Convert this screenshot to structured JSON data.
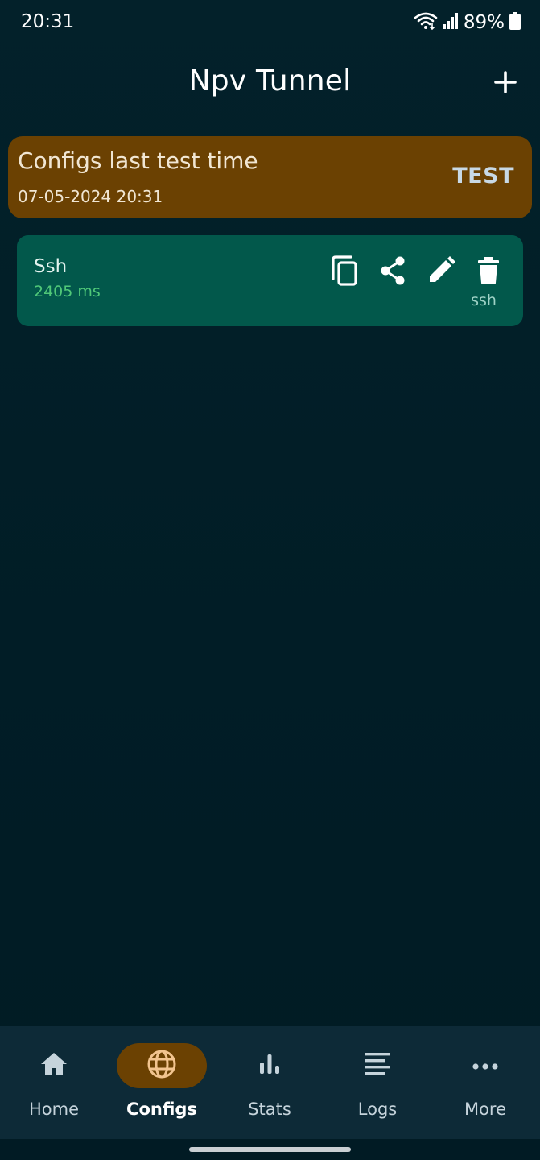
{
  "status_bar": {
    "time": "20:31",
    "battery_percent": "89%",
    "icons": [
      "wifi-icon",
      "signal-icon",
      "battery-icon"
    ]
  },
  "app_bar": {
    "title": "Npv Tunnel",
    "add_icon": "plus-icon"
  },
  "test_card": {
    "title": "Configs last test time",
    "timestamp": "07-05-2024 20:31",
    "button_label": "TEST"
  },
  "configs": [
    {
      "name": "Ssh",
      "latency": "2405 ms",
      "type": "ssh",
      "actions": [
        "copy-icon",
        "share-icon",
        "edit-icon",
        "delete-icon"
      ]
    }
  ],
  "bottom_nav": {
    "items": [
      {
        "label": "Home",
        "icon": "home-icon",
        "active": false
      },
      {
        "label": "Configs",
        "icon": "globe-icon",
        "active": true
      },
      {
        "label": "Stats",
        "icon": "bar-chart-icon",
        "active": false
      },
      {
        "label": "Logs",
        "icon": "lines-icon",
        "active": false
      },
      {
        "label": "More",
        "icon": "more-dots-icon",
        "active": false
      }
    ]
  },
  "colors": {
    "background": "#011e27",
    "accent_brown": "#6b4102",
    "config_card": "#02584b",
    "latency_green": "#50c878",
    "nav_background": "#0d2a37"
  }
}
